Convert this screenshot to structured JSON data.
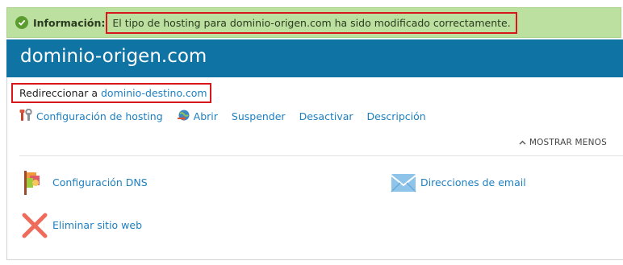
{
  "notice": {
    "label": "Información:",
    "message": "El tipo de hosting para dominio-origen.com ha sido modificado correctamente."
  },
  "header": {
    "title": "dominio-origen.com"
  },
  "redirect": {
    "prefix": "Redireccionar a",
    "target": "dominio-destino.com"
  },
  "actions": [
    {
      "label": "Configuración de hosting",
      "icon": "tools-icon"
    },
    {
      "label": "Abrir",
      "icon": "globe-arrow-icon"
    },
    {
      "label": "Suspender"
    },
    {
      "label": "Desactivar"
    },
    {
      "label": "Descripción"
    }
  ],
  "toggle": {
    "label": "MOSTRAR MENOS",
    "icon": "chevron-up-icon"
  },
  "tools": [
    {
      "label": "Configuración DNS",
      "icon": "dns-flag-icon"
    },
    {
      "label": "Direcciones de email",
      "icon": "envelope-icon"
    },
    {
      "label": "Eliminar sitio web",
      "icon": "delete-x-icon"
    }
  ],
  "colors": {
    "notice_bg": "#bce0a0",
    "header_bg": "#0f73a4",
    "link": "#1d7fbf",
    "highlight_border": "#d8171d"
  }
}
